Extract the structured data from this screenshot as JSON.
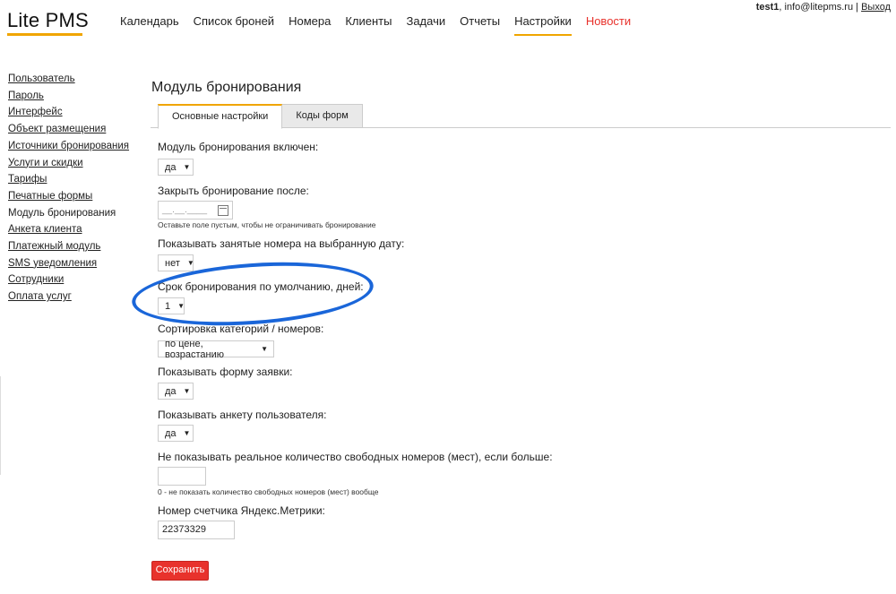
{
  "app": {
    "logo": "Lite PMS"
  },
  "topnav": {
    "items": [
      {
        "label": "Календарь"
      },
      {
        "label": "Список броней"
      },
      {
        "label": "Номера"
      },
      {
        "label": "Клиенты"
      },
      {
        "label": "Задачи"
      },
      {
        "label": "Отчеты"
      },
      {
        "label": "Настройки"
      },
      {
        "label": "Новости"
      }
    ],
    "active": "Настройки"
  },
  "userbar": {
    "user": "test1",
    "email": ", info@litepms.ru",
    "separator": " | ",
    "logout": "Выход"
  },
  "sidebar": {
    "items": [
      {
        "label": "Пользователь"
      },
      {
        "label": "Пароль"
      },
      {
        "label": "Интерфейс"
      },
      {
        "label": "Объект размещения"
      },
      {
        "label": "Источники бронирования"
      },
      {
        "label": "Услуги и скидки"
      },
      {
        "label": "Тарифы"
      },
      {
        "label": "Печатные формы"
      },
      {
        "label": "Модуль бронирования"
      },
      {
        "label": "Анкета клиента"
      },
      {
        "label": "Платежный модуль"
      },
      {
        "label": "SMS уведомления"
      },
      {
        "label": "Сотрудники"
      },
      {
        "label": "Оплата услуг"
      }
    ],
    "current": "Модуль бронирования"
  },
  "main": {
    "title": "Модуль бронирования",
    "tabs": [
      {
        "label": "Основные настройки"
      },
      {
        "label": "Коды форм"
      }
    ],
    "form": {
      "enabled_label": "Модуль бронирования включен:",
      "enabled_value": "да",
      "close_label": "Закрыть бронирование после:",
      "close_placeholder": "__.__.____",
      "close_hint": "Оставьте поле пустым, чтобы не ограничивать бронирование",
      "busy_label": "Показывать занятые номера на выбранную дату:",
      "busy_value": "нет",
      "term_label": "Срок бронирования по умолчанию, дней:",
      "term_value": "1",
      "sort_label": "Сортировка категорий / номеров:",
      "sort_value": "по цене, возрастанию",
      "request_label": "Показывать форму заявки:",
      "request_value": "да",
      "profile_label": "Показывать анкету пользователя:",
      "profile_value": "да",
      "hide_label": "Не показывать реальное количество свободных номеров (мест), если больше:",
      "hide_value": "",
      "hide_hint": "0 - не показать количество свободных номеров (мест) вообще",
      "metrika_label": "Номер счетчика Яндекс.Метрики:",
      "metrika_value": "22373329"
    },
    "save_label": "Сохранить"
  },
  "colors": {
    "accent": "#f0a500",
    "news": "#e8322c",
    "save": "#e8322c",
    "annotation": "#1a66d9"
  },
  "icons": {
    "calendar": "calendar-icon",
    "dropdown": "dropdown-arrow-icon"
  }
}
